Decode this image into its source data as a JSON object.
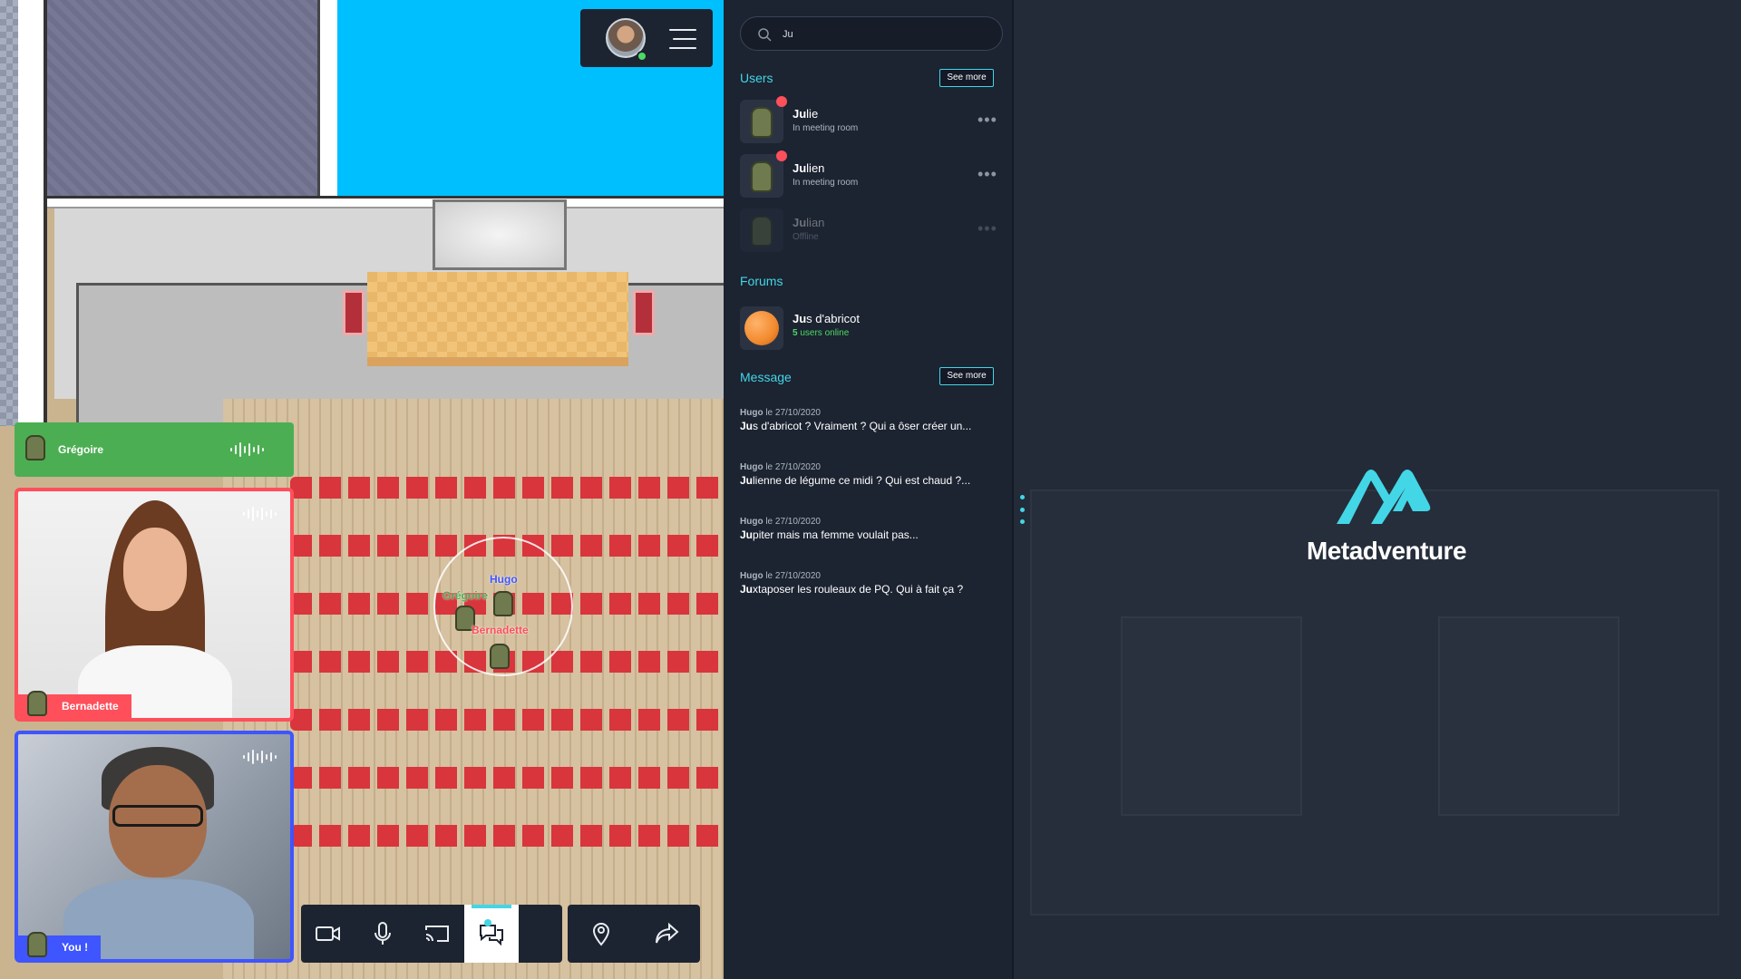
{
  "map": {
    "players": [
      {
        "name": "Hugo",
        "color": "#3e55ff"
      },
      {
        "name": "Grégoire",
        "color": "#4cae52"
      },
      {
        "name": "Bernadette",
        "color": "#ff4f5b"
      }
    ]
  },
  "talking": {
    "name": "Grégoire"
  },
  "video": {
    "bernadette_label": "Bernadette",
    "you_label": "You !"
  },
  "toolbar": {
    "buttons": [
      "camera-icon",
      "microphone-icon",
      "screen-share-icon",
      "chat-icon",
      "location-pin-icon",
      "share-icon"
    ],
    "active": "chat-icon"
  },
  "search": {
    "value": "Ju",
    "placeholder": ""
  },
  "users": {
    "title": "Users",
    "see_more": "See more",
    "items": [
      {
        "match": "Ju",
        "rest": "lie",
        "status": "In meeting room",
        "busy": true
      },
      {
        "match": "Ju",
        "rest": "lien",
        "status": "In meeting room",
        "busy": true
      },
      {
        "match": "Ju",
        "rest": "lian",
        "status": "Offline",
        "busy": false
      }
    ]
  },
  "forums": {
    "title": "Forums",
    "items": [
      {
        "match": "Ju",
        "rest": "s d'abricot",
        "count": "5",
        "count_suffix": " users online"
      }
    ]
  },
  "messages": {
    "title": "Message",
    "see_more": "See more",
    "items": [
      {
        "author": "Hugo",
        "date": " le 27/10/2020",
        "match": "Ju",
        "rest": "s d'abricot ? Vraiment ? Qui a ôser créer un..."
      },
      {
        "author": "Hugo",
        "date": " le 27/10/2020",
        "match": "Ju",
        "rest": "lienne de légume ce midi ? Qui est chaud ?..."
      },
      {
        "author": "Hugo",
        "date": " le 27/10/2020",
        "match": "Ju",
        "rest": "piter mais ma femme voulait pas..."
      },
      {
        "author": "Hugo",
        "date": " le 27/10/2020",
        "match": "Ju",
        "rest": "xtaposer les rouleaux de PQ. Qui à fait ça ?"
      }
    ]
  },
  "brand": {
    "name": "Metadventure",
    "accent": "#43d6e6"
  }
}
